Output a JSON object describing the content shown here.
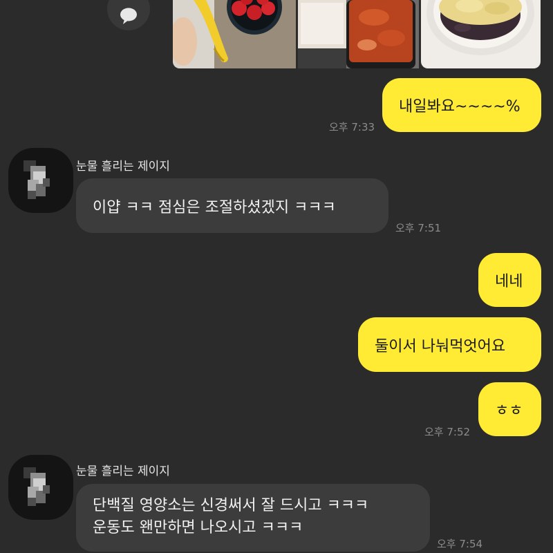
{
  "messages": {
    "m1": {
      "text": "내일봐요~~~~%",
      "time": "오후 7:33"
    },
    "m2": {
      "sender": "눈물 흘리는 제이지",
      "text": "이얍 ㅋㅋ 점심은 조절하셨겠지 ㅋㅋㅋ",
      "time": "오후 7:51"
    },
    "m3": {
      "text": "네네"
    },
    "m4": {
      "text": "둘이서 나눠먹엇어요"
    },
    "m5": {
      "text": "ㅎㅎ",
      "time": "오후 7:52"
    },
    "m6": {
      "sender": "눈물 흘리는 제이지",
      "line1": "단백질 영양소는 신경써서 잘 드시고 ㅋㅋㅋ",
      "line2": "운동도 왠만하면 나오시고 ㅋㅋㅋ",
      "time": "오후 7:54"
    }
  },
  "colors": {
    "background": "#2b2b2b",
    "my_bubble": "#ffeb33",
    "other_bubble": "#3c3c3c"
  },
  "icons": {
    "share": "speech-bubble-icon",
    "avatar": "pixelated-profile-photo"
  }
}
